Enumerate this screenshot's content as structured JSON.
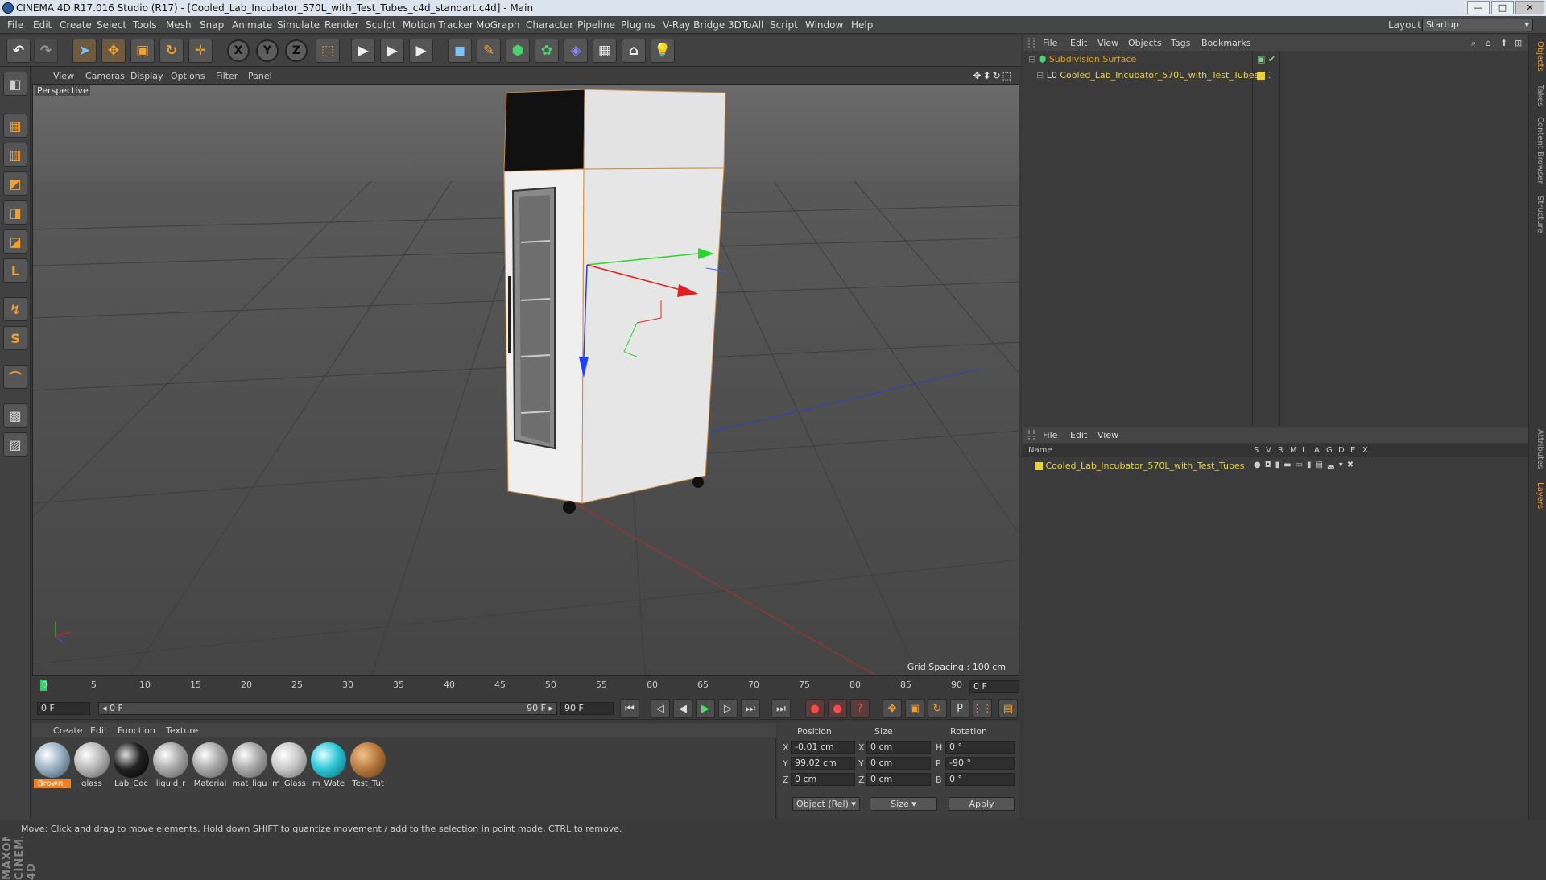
{
  "window": {
    "title": "CINEMA 4D R17.016 Studio (R17) - [Cooled_Lab_Incubator_570L_with_Test_Tubes_c4d_standart.c4d] - Main",
    "minimize": "—",
    "maximize": "□",
    "close": "✕"
  },
  "menubar": {
    "items": [
      "File",
      "Edit",
      "Create",
      "Select",
      "Tools",
      "Mesh",
      "Snap",
      "Animate",
      "Simulate",
      "Render",
      "Sculpt",
      "Motion Tracker",
      "MoGraph",
      "Character",
      "Pipeline",
      "Plugins",
      "V-Ray Bridge",
      "3DToAll",
      "Script",
      "Window",
      "Help"
    ],
    "layout_label": "Layout:",
    "layout_value": "Startup"
  },
  "toolbar": {
    "undo": "↶",
    "redo": "↷",
    "select": "➤",
    "move": "✥",
    "scale": "▣",
    "rotate": "↻",
    "add": "✛",
    "x": "X",
    "y": "Y",
    "z": "Z",
    "coord": "⬚",
    "render1": "▶",
    "render2": "▶",
    "render3": "▶",
    "cube": "◼",
    "pen": "✎",
    "subd": "⬢",
    "array": "✿",
    "deform": "◈",
    "floor": "▦",
    "camera": "⌂",
    "light": "💡"
  },
  "lefttools": [
    "◧",
    "▦",
    "▥",
    "◩",
    "◨",
    "◪",
    "L",
    "↯",
    "S",
    "⌒",
    "▩",
    "▨"
  ],
  "viewport": {
    "menu": [
      "View",
      "Cameras",
      "Display",
      "Options",
      "Filter",
      "Panel"
    ],
    "nav_icons": "✥⬍↻⬚",
    "label": "Perspective",
    "grid_spacing": "Grid Spacing : 100 cm"
  },
  "timeline": {
    "ticks": [
      "0",
      "5",
      "10",
      "15",
      "20",
      "25",
      "30",
      "35",
      "40",
      "45",
      "50",
      "55",
      "60",
      "65",
      "70",
      "75",
      "80",
      "85",
      "90"
    ],
    "current_frame": "0 F"
  },
  "transport": {
    "start_field": "0 F",
    "range_start": "◂ 0 F",
    "range_end": "90 F ▸",
    "end_field": "90 F",
    "buttons": [
      "⏮",
      "◁",
      "◀",
      "▶",
      "▷",
      "⏭",
      "⏭"
    ],
    "keys": [
      "●",
      "●",
      "?"
    ],
    "modes": [
      "✥",
      "▣",
      "↻",
      "P",
      "⋮⋮"
    ]
  },
  "materials": {
    "menu": [
      "Create",
      "Edit",
      "Function",
      "Texture"
    ],
    "items": [
      {
        "name": "Brown_",
        "color": "#9ab0c4",
        "selected": true
      },
      {
        "name": "glass",
        "color": "#b7b7b7"
      },
      {
        "name": "Lab_Coc",
        "color": "#222222"
      },
      {
        "name": "liquid_r",
        "color": "#a8a8a8"
      },
      {
        "name": "Material",
        "color": "#a8a8a8"
      },
      {
        "name": "mat_liqu",
        "color": "#a8a8a8"
      },
      {
        "name": "m_Glass",
        "color": "#c8c8c8"
      },
      {
        "name": "m_Wate",
        "color": "#2fc6d8"
      },
      {
        "name": "Test_Tut",
        "color": "#b87a40"
      }
    ]
  },
  "coords": {
    "headers": {
      "position": "Position",
      "size": "Size",
      "rotation": "Rotation"
    },
    "rows": [
      {
        "axis": "X",
        "pos": "-0.01 cm",
        "saxis": "X",
        "size": "0 cm",
        "raxis": "H",
        "rot": "0 °"
      },
      {
        "axis": "Y",
        "pos": "99.02 cm",
        "saxis": "Y",
        "size": "0 cm",
        "raxis": "P",
        "rot": "-90 °"
      },
      {
        "axis": "Z",
        "pos": "0 cm",
        "saxis": "Z",
        "size": "0 cm",
        "raxis": "B",
        "rot": "0 °"
      }
    ],
    "mode": "Object (Rel)",
    "size_mode": "Size",
    "apply": "Apply"
  },
  "status": "Move: Click and drag to move elements. Hold down SHIFT to quantize movement / add to the selection in point mode, CTRL to remove.",
  "objects": {
    "menu": [
      "File",
      "Edit",
      "View",
      "Objects",
      "Tags",
      "Bookmarks"
    ],
    "items": [
      {
        "name": "Subdivision Surface",
        "color": "#e0a020"
      },
      {
        "name": "Cooled_Lab_Incubator_570L_with_Test_Tubes",
        "color": "#e8d040"
      }
    ]
  },
  "layers": {
    "menu": [
      "File",
      "Edit",
      "View"
    ],
    "header": {
      "name": "Name",
      "cols": [
        "S",
        "V",
        "R",
        "M",
        "L",
        "A",
        "G",
        "D",
        "E",
        "X"
      ]
    },
    "items": [
      {
        "name": "Cooled_Lab_Incubator_570L_with_Test_Tubes",
        "color": "#e8d040"
      }
    ]
  },
  "right_tabs": [
    "Objects",
    "Takes",
    "Content Browser",
    "Structure",
    "Attributes",
    "Layers"
  ],
  "logo": "MAXON CINEMA 4D"
}
